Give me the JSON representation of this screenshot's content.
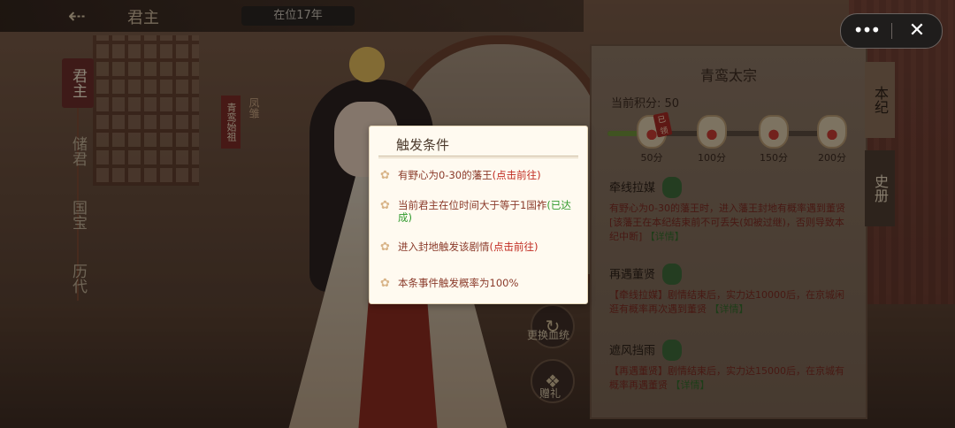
{
  "header": {
    "back_icon": "back-arrow-icon",
    "title": "君主",
    "reign": "在位17年"
  },
  "left_nav": {
    "items": [
      {
        "label": "君主",
        "active": true
      },
      {
        "label": "储君",
        "active": false
      },
      {
        "label": "国宝",
        "active": false
      },
      {
        "label": "历代",
        "active": false
      }
    ]
  },
  "ribbon": {
    "text1": "青鸾始祖",
    "text2": "凤雏"
  },
  "panel": {
    "title": "青鸾太宗",
    "score_label": "当前积分: 50",
    "progress_fraction": 0.2,
    "rewards": [
      {
        "label": "50分",
        "stamp": "已领"
      },
      {
        "label": "100分",
        "stamp": ""
      },
      {
        "label": "150分",
        "stamp": ""
      },
      {
        "label": "200分",
        "stamp": ""
      }
    ],
    "events": [
      {
        "name": "牵线拉媒",
        "desc": "有野心为0-30的藩王时，进入藩王封地有概率遇到董贤[该藩王在本纪结束前不可丢失(如被过继)，否则导致本纪中断]",
        "link": "【详情】"
      },
      {
        "name": "再遇董贤",
        "desc": "【牵线拉媒】剧情结束后，实力达10000后，在京城闲逛有概率再次遇到董贤",
        "link": "【详情】"
      },
      {
        "name": "遮风挡雨",
        "desc": "【再遇董贤】剧情结束后，实力达15000后，在京城有概率再遇董贤",
        "link": "【详情】"
      }
    ]
  },
  "tabs": {
    "active": "本纪",
    "inactive": "史册"
  },
  "actions": {
    "switch_label": "更换血统",
    "gift_label": "赠礼"
  },
  "capsule": {
    "more_icon": "more-dots-icon",
    "more_glyph": "•••",
    "close_icon": "close-icon",
    "close_glyph": "✕"
  },
  "modal": {
    "title": "触发条件",
    "conditions": [
      {
        "text": "有野心为0-30的藩王",
        "suffix": "(点击前往)",
        "suffix_color": "#c02a20"
      },
      {
        "text": "当前君主在位时间大于等于1国祚",
        "suffix": "(已达成)",
        "suffix_color": "#2f9a2c"
      },
      {
        "text": "进入封地触发该剧情",
        "suffix": "(点击前往)",
        "suffix_color": "#c02a20"
      },
      {
        "text": "本条事件触发概率为100%",
        "suffix": "",
        "suffix_color": ""
      }
    ]
  }
}
